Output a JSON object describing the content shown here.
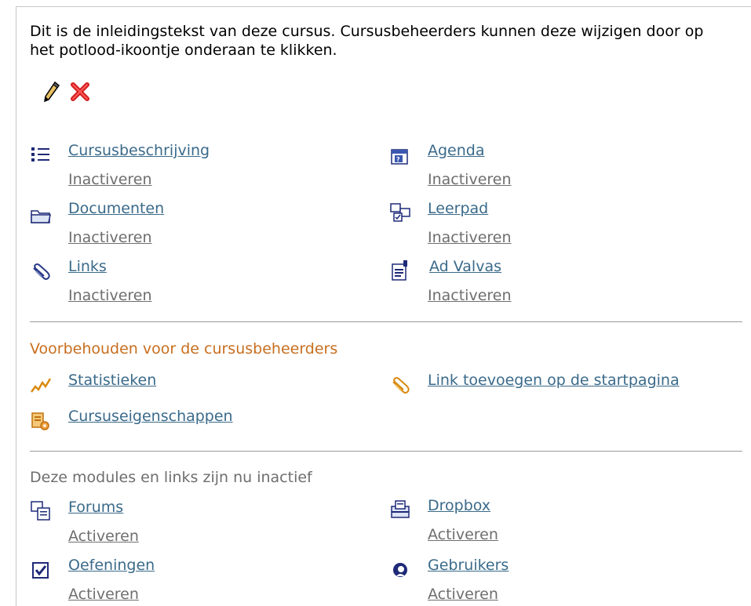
{
  "intro": "Dit is de inleidingstekst van deze cursus. Cursusbeheerders kunnen deze wijzigen door op het potlood-ikoontje onderaan te klikken.",
  "active_modules": [
    {
      "label": "Cursusbeschrijving",
      "action": "Inactiveren",
      "icon": "list-icon"
    },
    {
      "label": "Agenda",
      "action": "Inactiveren",
      "icon": "agenda-icon"
    },
    {
      "label": "Documenten",
      "action": "Inactiveren",
      "icon": "folder-icon"
    },
    {
      "label": "Leerpad",
      "action": "Inactiveren",
      "icon": "learning-path-icon"
    },
    {
      "label": "Links",
      "action": "Inactiveren",
      "icon": "paperclip-icon"
    },
    {
      "label": "Ad Valvas",
      "action": "Inactiveren",
      "icon": "announcement-icon"
    }
  ],
  "admin_section": {
    "title": "Voorbehouden voor de cursusbeheerders",
    "title_color": "#c86e1e",
    "items": [
      {
        "label": "Statistieken",
        "icon": "statistics-icon"
      },
      {
        "label": "Link toevoegen op de startpagina",
        "icon": "add-link-icon"
      },
      {
        "label": "Cursuseigenschappen",
        "icon": "course-settings-icon"
      }
    ]
  },
  "inactive_section": {
    "title": "Deze modules en links zijn nu inactief",
    "title_color": "#6e6e6e",
    "items": [
      {
        "label": "Forums",
        "action": "Activeren",
        "icon": "forums-icon"
      },
      {
        "label": "Dropbox",
        "action": "Activeren",
        "icon": "dropbox-icon"
      },
      {
        "label": "Oefeningen",
        "action": "Activeren",
        "icon": "checkbox-icon"
      },
      {
        "label": "Gebruikers",
        "action": "Activeren",
        "icon": "users-icon"
      }
    ]
  },
  "colors": {
    "link": "#3a6a8a",
    "action": "#6e6e6e",
    "delete": "#d21e1e"
  }
}
